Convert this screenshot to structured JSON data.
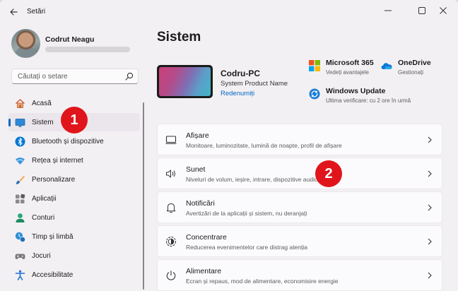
{
  "window": {
    "title": "Setări"
  },
  "profile": {
    "name": "Codrut Neagu"
  },
  "search": {
    "placeholder": "Căutați o setare"
  },
  "sidebar": {
    "items": [
      {
        "label": "Acasă",
        "icon": "home-icon"
      },
      {
        "label": "Sistem",
        "icon": "system-icon",
        "active": true
      },
      {
        "label": "Bluetooth și dispozitive",
        "icon": "bluetooth-icon"
      },
      {
        "label": "Rețea și internet",
        "icon": "wifi-icon"
      },
      {
        "label": "Personalizare",
        "icon": "brush-icon"
      },
      {
        "label": "Aplicații",
        "icon": "apps-icon"
      },
      {
        "label": "Conturi",
        "icon": "account-icon"
      },
      {
        "label": "Timp și limbă",
        "icon": "time-language-icon"
      },
      {
        "label": "Jocuri",
        "icon": "gamepad-icon"
      },
      {
        "label": "Accesibilitate",
        "icon": "accessibility-icon"
      }
    ]
  },
  "main": {
    "title": "Sistem",
    "device": {
      "name": "Codru-PC",
      "model": "System Product Name",
      "rename": "Redenumiți"
    },
    "quick": [
      {
        "title": "Microsoft 365",
        "subtitle": "Vedeți avantajele",
        "icon": "microsoft365-icon"
      },
      {
        "title": "OneDrive",
        "subtitle": "Gestionați",
        "icon": "onedrive-icon"
      },
      {
        "title": "Windows Update",
        "subtitle": "Ultima verificare: cu 2 ore în urmă",
        "icon": "windows-update-icon"
      }
    ],
    "cards": [
      {
        "title": "Afișare",
        "subtitle": "Monitoare, luminozitate, lumină de noapte, profil de afișare",
        "icon": "display-icon"
      },
      {
        "title": "Sunet",
        "subtitle": "Niveluri de volum, ieșire, intrare, dispozitive audio",
        "icon": "speaker-icon"
      },
      {
        "title": "Notificări",
        "subtitle": "Avertizări de la aplicații și sistem, nu deranjați",
        "icon": "bell-icon"
      },
      {
        "title": "Concentrare",
        "subtitle": "Reducerea evenimentelor care distrag atenția",
        "icon": "focus-icon"
      },
      {
        "title": "Alimentare",
        "subtitle": "Ecran și repaus, mod de alimentare, economisire energie",
        "icon": "power-icon"
      }
    ]
  },
  "markers": [
    "1",
    "2"
  ],
  "colors": {
    "accent": "#0067c0",
    "marker": "#e0151b",
    "background": "#f3f0f4"
  }
}
